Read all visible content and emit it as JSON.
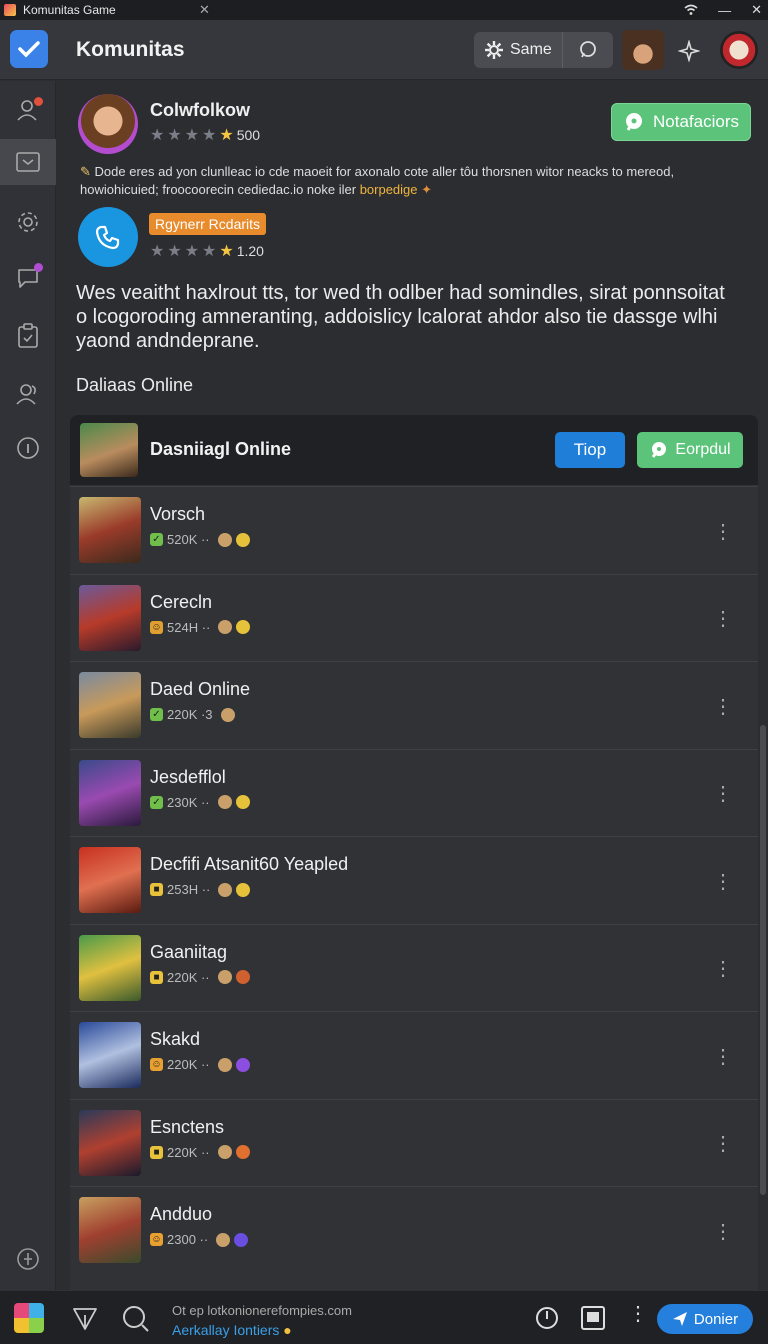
{
  "window": {
    "title": "Komunitas Game",
    "close_glyph": "✕",
    "controls": [
      "wifi-icon",
      "minimize-icon",
      "close-icon"
    ]
  },
  "header": {
    "brand": "Komunitas",
    "same_label": "Same"
  },
  "sidebar": {
    "items": [
      {
        "icon": "user-icon",
        "badge_color": "#e0503a"
      },
      {
        "icon": "inbox-icon",
        "active": true
      },
      {
        "icon": "gear-icon"
      },
      {
        "icon": "chat-bubble-icon",
        "badge_color": "#b04ccf"
      },
      {
        "icon": "clipboard-icon"
      },
      {
        "icon": "users-icon"
      },
      {
        "icon": "info-icon"
      }
    ],
    "bottom_icon": "plus-circle-icon"
  },
  "profile": {
    "name": "Colwfolkow",
    "rating_value": "500",
    "notif_label": "Notafaciors",
    "description_main": "Dode eres ad yon clunlleac io cde maoeit for axonalo cote aller tôu thorsnen witor neacks to mereod, howiohicuied; froocoorecin cediedac.io noke iler",
    "description_highlight": "borpedige"
  },
  "post": {
    "tag": "Rgynerr Rcdarits",
    "rating_value": "1.20",
    "paragraph": "Wes veaitht haxlrout tts, tor wed th odlber had somindles, sirat ponnsoitat o lcogoroding amneranting, addoislicy lcalorat ahdor also tie dassge wlhi yaond andndeprane."
  },
  "section_label": "Daliaas Online",
  "panel": {
    "title": "Dasniiagl Online",
    "tiop_label": "Tiop",
    "eorpdul_label": "Eorpdul"
  },
  "games": [
    {
      "name": "Vorsch",
      "stat": "520K ·· ",
      "badge": "check",
      "badge_color": "#6fbf4a",
      "emoji_color": "#e6c23a"
    },
    {
      "name": "Cerecln",
      "stat": "524H ·· ",
      "badge": "face",
      "badge_color": "#e0a030",
      "emoji_color": "#e6c23a"
    },
    {
      "name": "Daed Online",
      "stat": "220K ·3",
      "badge": "check",
      "badge_color": "#6fbf4a",
      "emoji_color": ""
    },
    {
      "name": "Jesdefflol",
      "stat": "230K ·· ",
      "badge": "check",
      "badge_color": "#6fbf4a",
      "emoji_color": "#e6c23a"
    },
    {
      "name": "Decfifi Atsanit60 Yeapled",
      "stat": "253H ·· ",
      "badge": "square",
      "badge_color": "#e8c23a",
      "emoji_color": "#e6c23a"
    },
    {
      "name": "Gaaniitag",
      "stat": "220K ·· ",
      "badge": "square",
      "badge_color": "#e8c23a",
      "emoji_color": "#d06030"
    },
    {
      "name": "Skakd",
      "stat": "220K ·· ",
      "badge": "face",
      "badge_color": "#e8a030",
      "emoji_color": "#8c4ee0"
    },
    {
      "name": "Esnctens",
      "stat": "220K ·· ",
      "badge": "square",
      "badge_color": "#e8c23a",
      "emoji_color": "#e07030"
    },
    {
      "name": "Andduo",
      "stat": "2300 ·· ",
      "badge": "face",
      "badge_color": "#e8a030",
      "emoji_color": "#6a4ee0"
    }
  ],
  "footer": {
    "line1": "Ot ep lotkonionerefompies.com",
    "line2": "Aerkallay Iontiers",
    "donate_label": "Donier"
  }
}
